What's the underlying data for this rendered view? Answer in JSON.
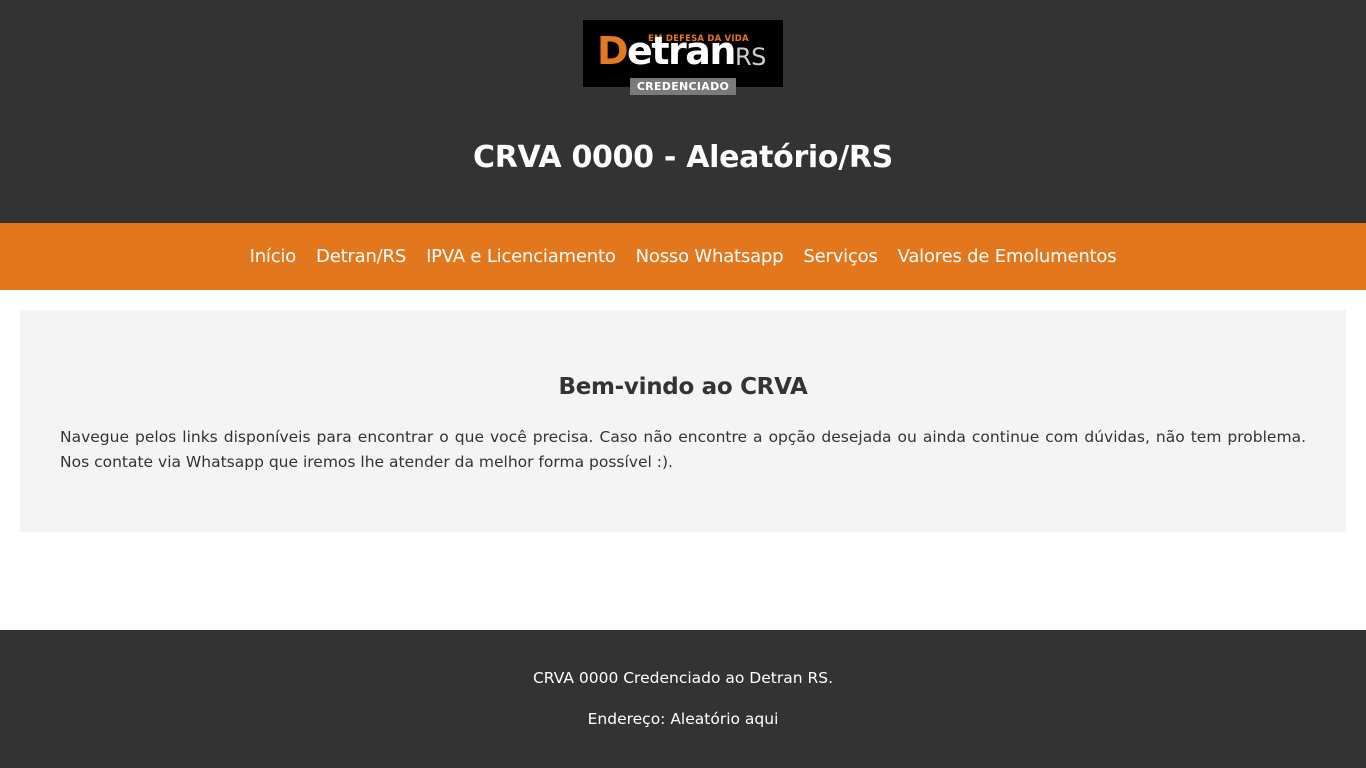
{
  "header": {
    "logo": {
      "tagline": "EM DEFESA DA VIDA",
      "word_first": "D",
      "word_rest": "etran",
      "word_suffix": "RS",
      "badge": "CREDENCIADO"
    },
    "title": "CRVA 0000 - Aleatório/RS"
  },
  "nav": {
    "items": [
      {
        "label": "Início"
      },
      {
        "label": "Detran/RS"
      },
      {
        "label": "IPVA e Licenciamento"
      },
      {
        "label": "Nosso Whatsapp"
      },
      {
        "label": "Serviços"
      },
      {
        "label": "Valores de Emolumentos"
      }
    ]
  },
  "main": {
    "heading": "Bem-vindo ao CRVA",
    "text": "Navegue pelos links disponíveis para encontrar o que você precisa. Caso não encontre a opção desejada ou ainda continue com dúvidas, não tem problema. Nos contate via Whatsapp que iremos lhe atender da melhor forma possível :)."
  },
  "footer": {
    "line1": "CRVA 0000 Credenciado ao Detran RS.",
    "line2": "Endereço: Aleatório aqui"
  },
  "colors": {
    "dark": "#333333",
    "accent": "#e2771d",
    "panel": "#f4f4f4"
  }
}
